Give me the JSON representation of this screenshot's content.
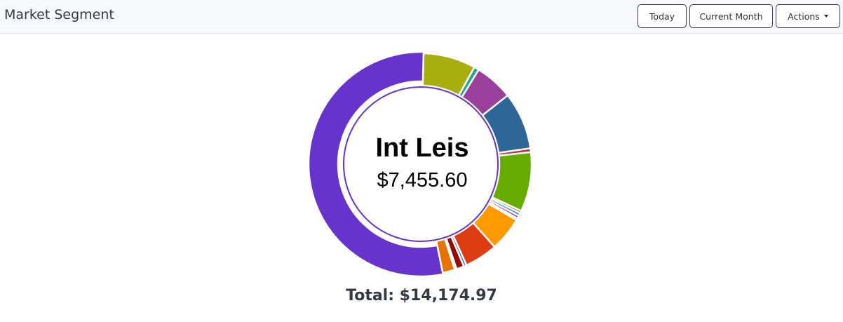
{
  "header": {
    "title": "Market Segment",
    "buttons": {
      "today": "Today",
      "current_month": "Current Month",
      "actions": "Actions"
    }
  },
  "chart_data": {
    "type": "pie",
    "style": "donut",
    "center_label": "Int Leis",
    "center_value": "$7,455.60",
    "total_label": "Total: $14,174.97",
    "slices": [
      {
        "value": 1064,
        "color": "#a8ae0e"
      },
      {
        "value": 99,
        "color": "#21a590"
      },
      {
        "value": 778,
        "color": "#9a3f9b"
      },
      {
        "value": 1164,
        "color": "#2e6698"
      },
      {
        "value": 78,
        "color": "#b8363d"
      },
      {
        "value": 1205,
        "color": "#66ab00"
      },
      {
        "value": 50,
        "color": "#dd4477"
      },
      {
        "value": 62,
        "color": "#1f9bbd"
      },
      {
        "value": 55,
        "color": "#8b138f"
      },
      {
        "value": 40,
        "color": "#36973a"
      },
      {
        "value": 695,
        "color": "#fd9a00"
      },
      {
        "value": 672,
        "color": "#dd3b12"
      },
      {
        "value": 58,
        "color": "#3a6ac8"
      },
      {
        "value": 154,
        "color": "#960a04"
      },
      {
        "value": 39,
        "color": "#808080"
      },
      {
        "value": 249,
        "color": "#e67300"
      },
      {
        "value": 7455.6,
        "color": "#6633cc"
      }
    ]
  }
}
